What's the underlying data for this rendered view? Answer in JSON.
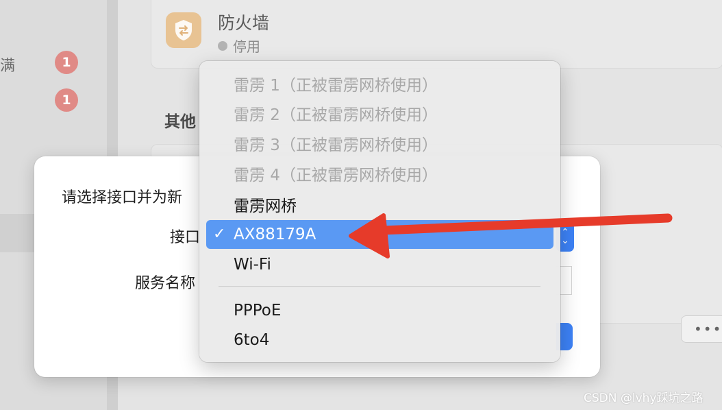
{
  "sidebar": {
    "row_text": "满",
    "badges": [
      "1",
      "1"
    ]
  },
  "background": {
    "firewall": {
      "title": "防火墙",
      "status": "停用"
    },
    "section_heading": "其他",
    "more_button": "•••"
  },
  "dialog": {
    "prompt": "请选择接口并为新",
    "interface_label": "接口",
    "service_name_label": "服务名称"
  },
  "menu": {
    "items": [
      {
        "label": "雷雳 1（正被雷雳网桥使用）",
        "enabled": false
      },
      {
        "label": "雷雳 2（正被雷雳网桥使用）",
        "enabled": false
      },
      {
        "label": "雷雳 3（正被雷雳网桥使用）",
        "enabled": false
      },
      {
        "label": "雷雳 4（正被雷雳网桥使用）",
        "enabled": false
      },
      {
        "label": "雷雳网桥",
        "enabled": true
      },
      {
        "label": "AX88179A",
        "enabled": true,
        "selected": true
      },
      {
        "label": "Wi-Fi",
        "enabled": true
      },
      {
        "label": "PPPoE",
        "enabled": true
      },
      {
        "label": "6to4",
        "enabled": true
      }
    ],
    "checkmark": "✓"
  },
  "watermark": "CSDN @lvhy踩坑之路",
  "colors": {
    "selection": "#5a99f3",
    "accent": "#3d82f6",
    "annotation_arrow": "#e63b2a",
    "badge": "#e08a86"
  }
}
